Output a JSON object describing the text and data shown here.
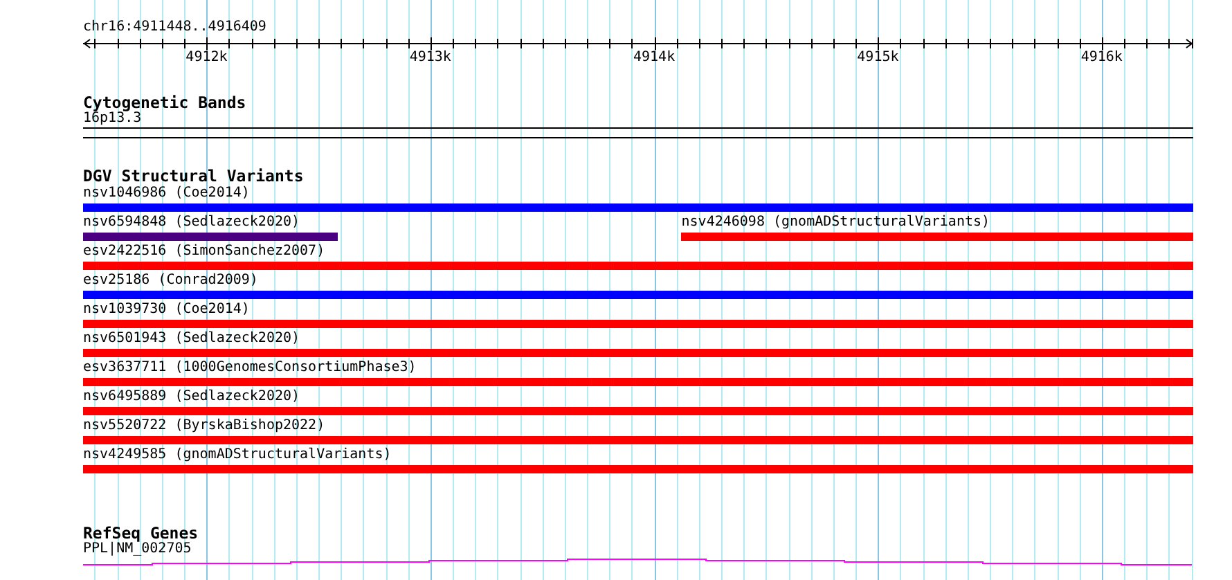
{
  "ruler": {
    "locus": "chr16:4911448..4916409",
    "tick_labels": [
      "4912k",
      "4913k",
      "4914k",
      "4915k",
      "4916k"
    ]
  },
  "tracks": [
    {
      "kind": "bands",
      "title": "Cytogenetic Bands",
      "bands": [
        "16p13.3"
      ]
    },
    {
      "kind": "variants",
      "title": "DGV Structural Variants",
      "rows": [
        {
          "features": [
            {
              "label": "nsv1046986 (Coe2014)",
              "color": "#0000ff",
              "level": 1,
              "kind": "start"
            }
          ]
        },
        {
          "features": [
            {
              "label": "nsv6594848 (Sedlazeck2020)",
              "color": "#4b0082",
              "level": 0.229,
              "kind": "start"
            },
            {
              "label": "nsv4246098 (gnomADStructuralVariants)",
              "color": "#ff0000",
              "level": 0.461,
              "kind": "end"
            }
          ]
        },
        {
          "features": [
            {
              "label": "esv2422516 (SimonSanchez2007)",
              "color": "#ff0000",
              "level": 1,
              "kind": "start"
            }
          ]
        },
        {
          "features": [
            {
              "label": "esv25186 (Conrad2009)",
              "color": "#0000ff",
              "level": 1,
              "kind": "start"
            }
          ]
        },
        {
          "features": [
            {
              "label": "nsv1039730 (Coe2014)",
              "color": "#ff0000",
              "level": 1,
              "kind": "start"
            }
          ]
        },
        {
          "features": [
            {
              "label": "nsv6501943 (Sedlazeck2020)",
              "color": "#ff0000",
              "level": 1,
              "kind": "start"
            }
          ]
        },
        {
          "features": [
            {
              "label": "esv3637711 (1000GenomesConsortiumPhase3)",
              "color": "#ff0000",
              "level": 1,
              "kind": "start"
            }
          ]
        },
        {
          "features": [
            {
              "label": "nsv6495889 (Sedlazeck2020)",
              "color": "#ff0000",
              "level": 1,
              "kind": "start"
            }
          ]
        },
        {
          "features": [
            {
              "label": "nsv5520722 (ByrskaBishop2022)",
              "color": "#ff0000",
              "level": 1,
              "kind": "start"
            }
          ]
        },
        {
          "features": [
            {
              "label": "nsv4249585 (gnomADStructuralVariants)",
              "color": "#ff0000",
              "level": 1,
              "kind": "start"
            }
          ]
        }
      ]
    },
    {
      "kind": "genes",
      "title": "RefSeq Genes",
      "genes": [
        "PPL|NM_002705"
      ]
    }
  ]
}
